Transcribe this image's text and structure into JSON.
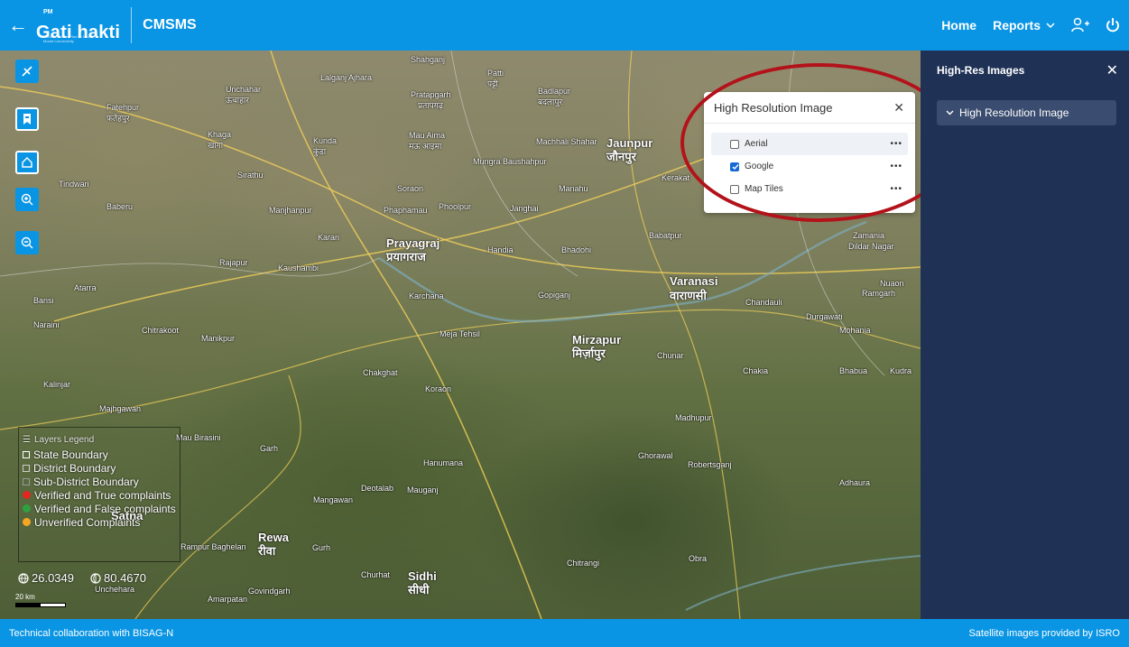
{
  "header": {
    "logo_pm": "PM",
    "logo_brand": "Gati hakti",
    "logo_tagline": "National Master Plan for Multi-Modal Connectivity",
    "app_title": "CMSMS",
    "nav_home": "Home",
    "nav_reports": "Reports"
  },
  "map": {
    "places": [
      {
        "name": "Fatehpur",
        "hi": "फतेहपुर"
      },
      {
        "name": "Unchahar",
        "hi": "ऊंचाहार"
      },
      {
        "name": "Lalganj Ajhara"
      },
      {
        "name": "Pratapgarh",
        "hi": "प्रतापगढ़"
      },
      {
        "name": "Patti",
        "hi": "पट्टी"
      },
      {
        "name": "Badlapur",
        "hi": "बदलापुर"
      },
      {
        "name": "Khaga",
        "hi": "खागा"
      },
      {
        "name": "Kunda",
        "hi": "कुंडा"
      },
      {
        "name": "Mau Aima",
        "hi": "मऊ आइमा"
      },
      {
        "name": "Mungra Baushahpur"
      },
      {
        "name": "Machhali Shahar"
      },
      {
        "name": "Jaunpur",
        "hi": "जौनपुर"
      },
      {
        "name": "Kerakat"
      },
      {
        "name": "Tindwari"
      },
      {
        "name": "Baberu"
      },
      {
        "name": "Sirathu"
      },
      {
        "name": "Soraon"
      },
      {
        "name": "Phaphamau"
      },
      {
        "name": "Phoolpur"
      },
      {
        "name": "Janghai"
      },
      {
        "name": "Manahu"
      },
      {
        "name": "Manjhanpur"
      },
      {
        "name": "Karari"
      },
      {
        "name": "Prayagraj",
        "hi": "प्रयागराज"
      },
      {
        "name": "Handia"
      },
      {
        "name": "Bhadohi"
      },
      {
        "name": "Babatpur"
      },
      {
        "name": "Rajapur"
      },
      {
        "name": "Kaushambi"
      },
      {
        "name": "Varanasi",
        "hi": "वाराणसी"
      },
      {
        "name": "Chandauli"
      },
      {
        "name": "Atarra"
      },
      {
        "name": "Karchana"
      },
      {
        "name": "Gopiganj"
      },
      {
        "name": "Bansi"
      },
      {
        "name": "Naraini"
      },
      {
        "name": "Chitrakoot"
      },
      {
        "name": "Meja Tehsil"
      },
      {
        "name": "Mirzapur",
        "hi": "मिर्ज़ापुर"
      },
      {
        "name": "Chunar"
      },
      {
        "name": "Mohania"
      },
      {
        "name": "Manikpur"
      },
      {
        "name": "Chakghat"
      },
      {
        "name": "Koraon"
      },
      {
        "name": "Chakia"
      },
      {
        "name": "Bhabua"
      },
      {
        "name": "Kalinjar"
      },
      {
        "name": "Majhgawan"
      },
      {
        "name": "Mau Birasini"
      },
      {
        "name": "Garh"
      },
      {
        "name": "Hanumana"
      },
      {
        "name": "Madhupur"
      },
      {
        "name": "Ghorawal"
      },
      {
        "name": "Robertsganj"
      },
      {
        "name": "Mangawan"
      },
      {
        "name": "Deotalab"
      },
      {
        "name": "Mauganj"
      },
      {
        "name": "Satna"
      },
      {
        "name": "Rewa",
        "hi": "रीवा"
      },
      {
        "name": "Rampur Baghelan"
      },
      {
        "name": "Gurh"
      },
      {
        "name": "Chitrangi"
      },
      {
        "name": "Obra"
      },
      {
        "name": "Sidhi",
        "hi": "सीधी"
      },
      {
        "name": "Churhat"
      },
      {
        "name": "Govindgarh"
      },
      {
        "name": "Amarpatan"
      },
      {
        "name": "Unchehara"
      },
      {
        "name": "Dildar Nagar"
      },
      {
        "name": "Zamania"
      },
      {
        "name": "Nuaon"
      },
      {
        "name": "Ramgarh"
      },
      {
        "name": "Durgawati"
      },
      {
        "name": "Kudra"
      },
      {
        "name": "Adhaura"
      },
      {
        "name": "Shahganj"
      }
    ],
    "latitude": "26.0349",
    "longitude": "80.4670",
    "scale_label": "20 km"
  },
  "legend": {
    "title": "Layers Legend",
    "items": [
      {
        "label": "State Boundary",
        "type": "square",
        "color": "#ffffff"
      },
      {
        "label": "District Boundary",
        "type": "square",
        "color": "#cccccc"
      },
      {
        "label": "Sub-District Boundary",
        "type": "square",
        "color": "#999999"
      },
      {
        "label": "Verified and True complaints",
        "type": "dot",
        "color": "#e3261d"
      },
      {
        "label": "Verified and False complaints",
        "type": "dot",
        "color": "#2ea043"
      },
      {
        "label": "Unverified Complaints",
        "type": "dot",
        "color": "#f5a623"
      }
    ]
  },
  "popup": {
    "title": "High Resolution Image",
    "options": [
      {
        "label": "Aerial",
        "checked": false
      },
      {
        "label": "Google",
        "checked": true
      },
      {
        "label": "Map Tiles",
        "checked": false
      }
    ]
  },
  "panel": {
    "title": "High-Res Images",
    "item_label": "High Resolution Image"
  },
  "footer": {
    "left": "Technical collaboration with BISAG-N",
    "right": "Satellite images provided by ISRO"
  },
  "colors": {
    "header": "#0a95e4",
    "panel": "#1f3256",
    "annotation": "#b3121a"
  }
}
